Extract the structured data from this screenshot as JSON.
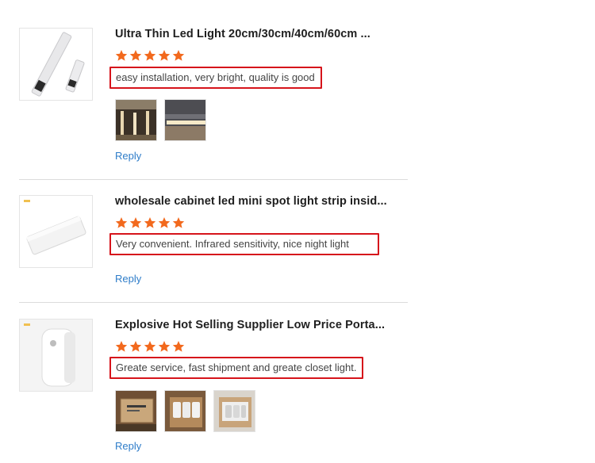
{
  "reviews": [
    {
      "title": "Ultra Thin Led Light 20cm/30cm/40cm/60cm ...",
      "rating": 5,
      "comment": "easy installation, very bright, quality is good",
      "reply": "Reply",
      "photo_count": 2
    },
    {
      "title": "wholesale cabinet led mini spot light strip insid...",
      "rating": 5,
      "comment": "Very convenient. Infrared sensitivity, nice night light",
      "reply": "Reply",
      "photo_count": 0
    },
    {
      "title": "Explosive Hot Selling Supplier Low Price Porta...",
      "rating": 5,
      "comment": "Greate service, fast shipment and greate closet light.",
      "reply": "Reply",
      "photo_count": 3
    }
  ],
  "colors": {
    "star": "#f2691d",
    "highlight_border": "#d6141b",
    "reply_link": "#2f7dc9"
  }
}
